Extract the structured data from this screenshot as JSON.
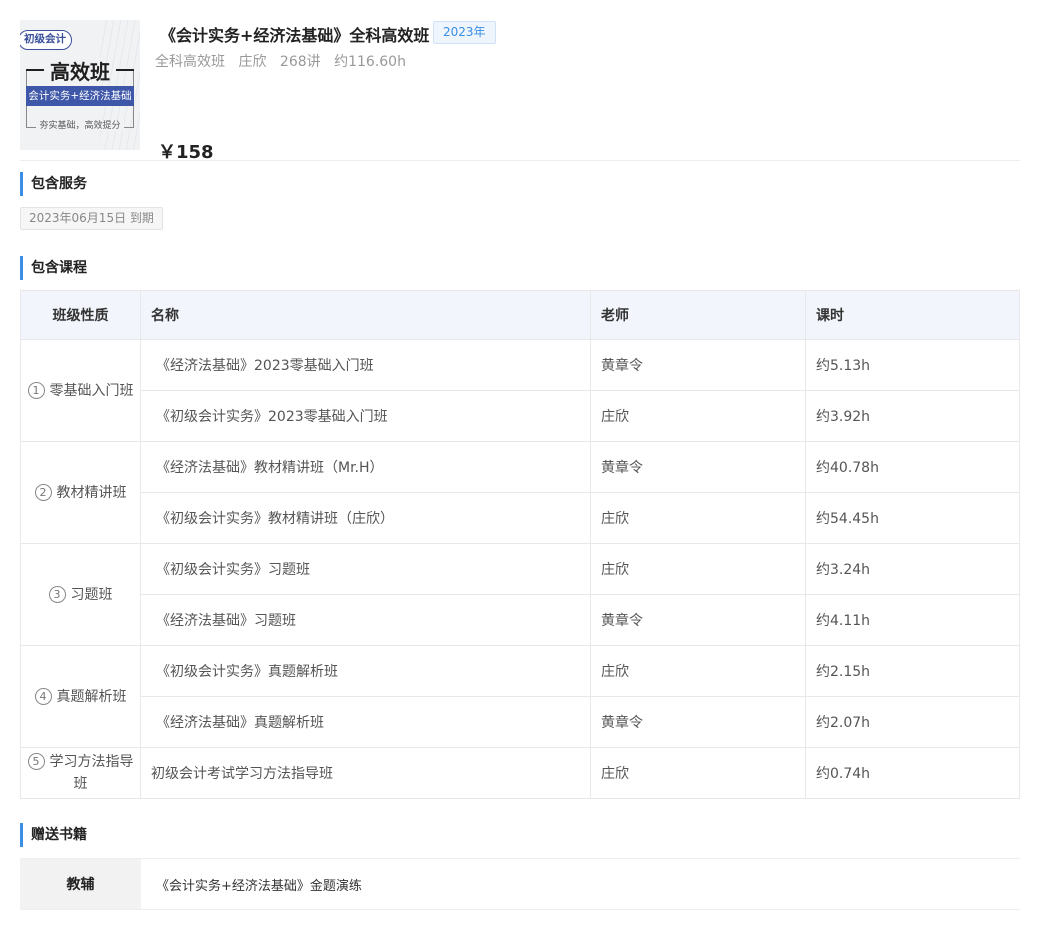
{
  "product": {
    "cover": {
      "tag": "初级会计",
      "big": "高效班",
      "band": "会计实务+经济法基础",
      "slogan": "夯实基础，高效提分"
    },
    "title": "《会计实务+经济法基础》全科高效班",
    "year_badge": "2023年",
    "meta": {
      "class_type": "全科高效班",
      "teacher": "庄欣",
      "lectures": "268讲",
      "hours": "约116.60h"
    },
    "price": "￥158"
  },
  "services": {
    "title": "包含服务",
    "expire": "2023年06月15日 到期"
  },
  "courses": {
    "title": "包含课程",
    "headers": [
      "班级性质",
      "名称",
      "老师",
      "课时"
    ],
    "groups": [
      {
        "num": "1",
        "kind": "零基础入门班",
        "rows": [
          {
            "name": "《经济法基础》2023零基础入门班",
            "teacher": "黄章令",
            "hours": "约5.13h"
          },
          {
            "name": "《初级会计实务》2023零基础入门班",
            "teacher": "庄欣",
            "hours": "约3.92h"
          }
        ]
      },
      {
        "num": "2",
        "kind": "教材精讲班",
        "rows": [
          {
            "name": "《经济法基础》教材精讲班（Mr.H）",
            "teacher": "黄章令",
            "hours": "约40.78h"
          },
          {
            "name": "《初级会计实务》教材精讲班（庄欣）",
            "teacher": "庄欣",
            "hours": "约54.45h"
          }
        ]
      },
      {
        "num": "3",
        "kind": "习题班",
        "rows": [
          {
            "name": "《初级会计实务》习题班",
            "teacher": "庄欣",
            "hours": "约3.24h"
          },
          {
            "name": "《经济法基础》习题班",
            "teacher": "黄章令",
            "hours": "约4.11h"
          }
        ]
      },
      {
        "num": "4",
        "kind": "真题解析班",
        "rows": [
          {
            "name": "《初级会计实务》真题解析班",
            "teacher": "庄欣",
            "hours": "约2.15h"
          },
          {
            "name": "《经济法基础》真题解析班",
            "teacher": "黄章令",
            "hours": "约2.07h"
          }
        ]
      },
      {
        "num": "5",
        "kind": "学习方法指导班",
        "rows": [
          {
            "name": "初级会计考试学习方法指导班",
            "teacher": "庄欣",
            "hours": "约0.74h"
          }
        ]
      }
    ]
  },
  "books": {
    "title": "赠送书籍",
    "label": "教辅",
    "value": "《会计实务+经济法基础》金题演练"
  },
  "colors": {
    "accent": "#3a8ee6",
    "table_head": "#f2f6fc"
  }
}
